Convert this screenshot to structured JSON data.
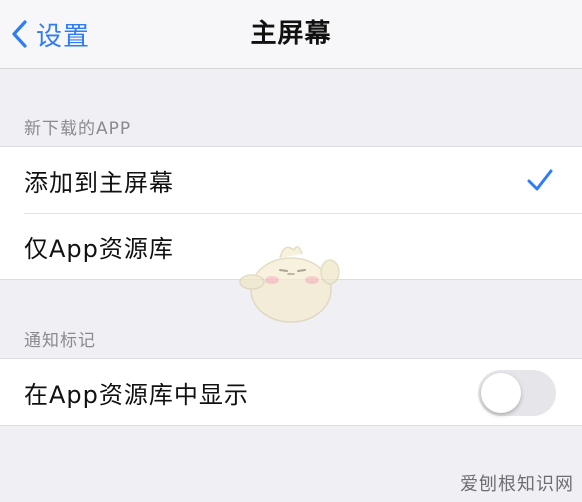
{
  "nav": {
    "back_label": "设置",
    "title": "主屏幕"
  },
  "section_new_apps": {
    "header": "新下载的APP",
    "options": [
      {
        "label": "添加到主屏幕",
        "selected": true
      },
      {
        "label": "仅App资源库",
        "selected": false
      }
    ]
  },
  "section_badges": {
    "header": "通知标记",
    "rows": [
      {
        "label": "在App资源库中显示",
        "toggle_on": false
      }
    ]
  },
  "colors": {
    "accent": "#2f7cf6",
    "background": "#efeff4",
    "toggle_off": "#e6e6ea"
  },
  "watermark": "爱刨根知识网"
}
